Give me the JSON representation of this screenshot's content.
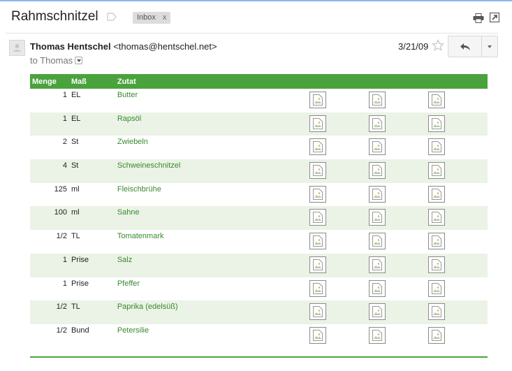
{
  "email": {
    "subject": "Rahmschnitzel",
    "label_chip": "Inbox",
    "label_remove": "x",
    "sender_name": "Thomas Hentschel",
    "sender_email": "<thomas@hentschel.net>",
    "to_line": "to Thomas",
    "date": "3/21/09"
  },
  "icons": {
    "label": "label-icon",
    "print": "print-icon",
    "new_window": "new-window-icon",
    "star": "star-icon",
    "reply": "reply-icon",
    "more": "chevron-down-icon",
    "broken_image": "broken-image-icon"
  },
  "colors": {
    "header_green": "#4aa23c",
    "row_alt": "#eaf3e6",
    "ingredient_text": "#3a8a2f"
  },
  "table": {
    "headers": [
      "Menge",
      "Maß",
      "Zutat"
    ],
    "rows": [
      {
        "qty": "1",
        "unit": "EL",
        "ingredient": "Butter"
      },
      {
        "qty": "1",
        "unit": "EL",
        "ingredient": "Rapsöl"
      },
      {
        "qty": "2",
        "unit": "St",
        "ingredient": "Zwiebeln"
      },
      {
        "qty": "4",
        "unit": "St",
        "ingredient": "Schweineschnitzel"
      },
      {
        "qty": "125",
        "unit": "ml",
        "ingredient": "Fleischbrühe"
      },
      {
        "qty": "100",
        "unit": "ml",
        "ingredient": "Sahne"
      },
      {
        "qty": "1/2",
        "unit": "TL",
        "ingredient": "Tomatenmark"
      },
      {
        "qty": "1",
        "unit": "Prise",
        "ingredient": "Salz"
      },
      {
        "qty": "1",
        "unit": "Prise",
        "ingredient": "Pfeffer"
      },
      {
        "qty": "1/2",
        "unit": "TL",
        "ingredient": "Paprika (edelsüß)"
      },
      {
        "qty": "1/2",
        "unit": "Bund",
        "ingredient": "Petersilie"
      }
    ]
  }
}
